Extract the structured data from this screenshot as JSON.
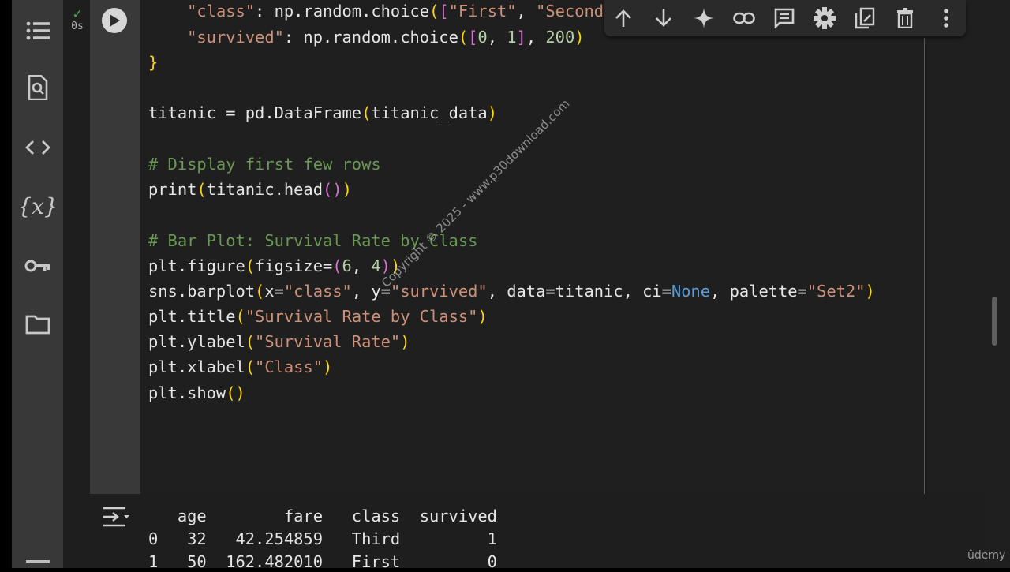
{
  "cell": {
    "status_time": "0s",
    "status_check": "✓"
  },
  "code_lines": [
    "    \"class\": np.random.choice([\"First\", \"Second",
    "    \"survived\": np.random.choice([0, 1], 200)",
    "}",
    "titanic = pd.DataFrame(titanic_data)",
    "# Display first few rows",
    "print(titanic.head())",
    "# Bar Plot: Survival Rate by Class",
    "plt.figure(figsize=(6, 4))",
    "sns.barplot(x=\"class\", y=\"survived\", data=titanic, ci=None, palette=\"Set2\")",
    "plt.title(\"Survival Rate by Class\")",
    "plt.ylabel(\"Survival Rate\")",
    "plt.xlabel(\"Class\")",
    "plt.show()"
  ],
  "sidebar": {
    "items": [
      {
        "icon": "table-of-contents-icon"
      },
      {
        "icon": "find-icon"
      },
      {
        "icon": "code-snippets-icon"
      },
      {
        "icon": "variables-icon",
        "label": "{x}"
      },
      {
        "icon": "secrets-key-icon"
      },
      {
        "icon": "files-folder-icon"
      }
    ]
  },
  "toolbar": {
    "buttons": [
      "move-up-icon",
      "move-down-icon",
      "gemini-sparkle-icon",
      "link-icon",
      "comment-icon",
      "settings-gear-icon",
      "mirror-cell-icon",
      "delete-icon",
      "more-options-icon"
    ]
  },
  "output": {
    "header": "   age        fare   class  survived",
    "rows": [
      "0   32   42.254859   Third         1",
      "1   50  162.482010   First         0"
    ]
  },
  "watermark": "Copyright © 2025 - www.p30download.com",
  "brand": "ûdemy"
}
